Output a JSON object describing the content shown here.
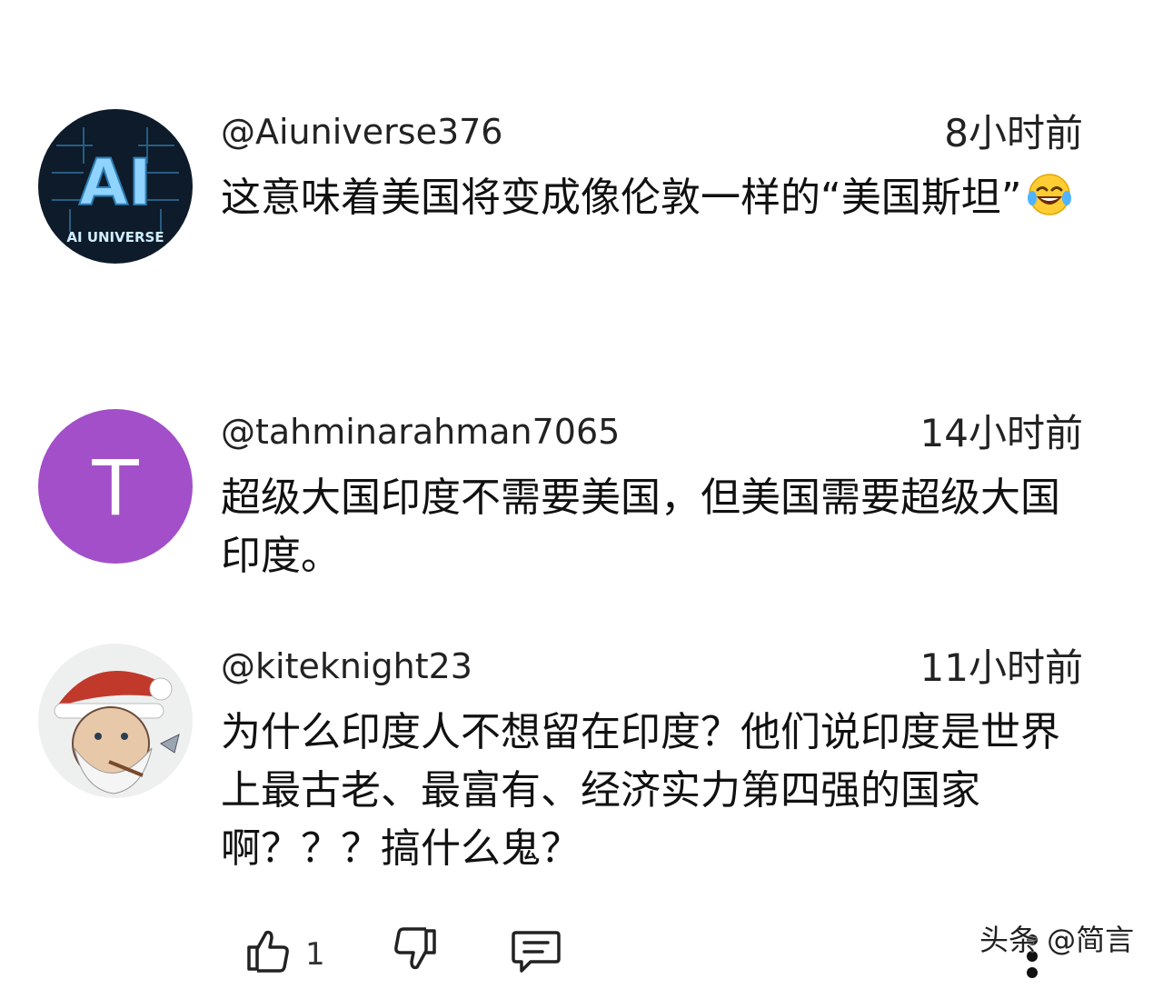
{
  "comments": [
    {
      "author": "@Aiuniverse376",
      "time": "8小时前",
      "text": "这意味着美国将变成像伦敦一样的“美国斯坦”",
      "emoji": "face-with-tears-of-joy-icon",
      "avatar": {
        "kind": "image",
        "big_text": "AI",
        "caption": "AI UNIVERSE",
        "bg": "#0d1b2a",
        "accent": "#4fb3e8"
      }
    },
    {
      "author": "@tahminarahman7065",
      "time": "14小时前",
      "text": "超级大国印度不需要美国，但美国需要超级大国印度。",
      "avatar": {
        "kind": "letter",
        "letter": "T",
        "bg": "#a24fc9"
      }
    },
    {
      "author": "@kiteknight23",
      "time": "11小时前",
      "text": "为什么印度人不想留在印度？他们说印度是世界上最古老、最富有、经济实力第四强的国家啊？？？搞什么鬼？",
      "avatar": {
        "kind": "image",
        "description_icon": "santa-hat-cartoon-avatar"
      }
    }
  ],
  "actions": {
    "like_count": "1",
    "like_icon": "thumbs-up-icon",
    "dislike_icon": "thumbs-down-icon",
    "reply_icon": "reply-comment-icon",
    "more_icon": "more-vertical-icon"
  },
  "watermark": "头条 @简言"
}
